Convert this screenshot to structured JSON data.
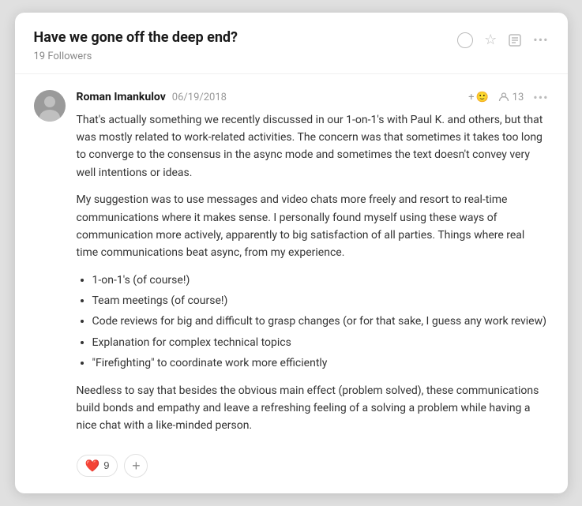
{
  "card": {
    "title": "Have we gone off the deep end?",
    "followers_label": "19 Followers",
    "header_actions": {
      "circle_icon": "circle-icon",
      "star_icon": "star-icon",
      "edit_icon": "edit-icon",
      "dots_icon": "more-options-icon"
    }
  },
  "post": {
    "author": "Roman Imankulov",
    "date": "06/19/2018",
    "add_reaction_label": "+😊",
    "followers_count": "13",
    "paragraphs": [
      "That's actually something we recently discussed in our 1-on-1's with Paul K. and others, but that was mostly related to work-related activities. The concern was that sometimes it takes too long to converge to the consensus in the async mode and sometimes the text doesn't convey very well intentions or ideas.",
      "My suggestion was to use messages and video chats more freely and resort to real-time communications where it makes sense. I personally found myself using these ways of communication more actively, apparently to big satisfaction of all parties. Things where real time communications beat async, from my experience."
    ],
    "list_items": [
      "1-on-1's (of course!)",
      "Team meetings (of course!)",
      "Code reviews for big and difficult to grasp changes (or for that sake, I guess any work review)",
      "Explanation for complex technical topics",
      "\"Firefighting\" to coordinate work more efficiently"
    ],
    "closing_paragraph": "Needless to say that besides the obvious main effect (problem solved), these communications build bonds and empathy and leave a refreshing feeling of a solving a problem while having a nice chat with a like-minded person.",
    "reactions": [
      {
        "emoji": "❤️",
        "count": "9"
      }
    ]
  }
}
